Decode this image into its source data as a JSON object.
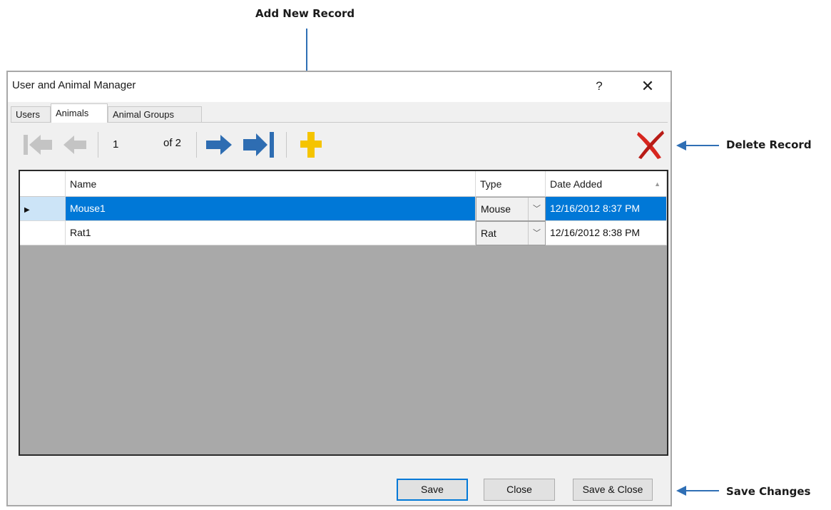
{
  "callouts": {
    "add_new_record": "Add New Record",
    "delete_record": "Delete Record",
    "save_changes": "Save Changes"
  },
  "dialog": {
    "title": "User and Animal Manager",
    "help_label": "?",
    "close_label": "✕"
  },
  "tabs": [
    {
      "label": "Users",
      "active": false
    },
    {
      "label": "Animals",
      "active": true
    },
    {
      "label": "Animal Groups",
      "active": false
    }
  ],
  "navigator": {
    "position": "1",
    "of_label": "of 2",
    "icons": [
      "move-first-icon",
      "move-previous-icon",
      "move-next-icon",
      "move-last-icon",
      "add-new-icon",
      "delete-icon"
    ]
  },
  "grid": {
    "columns": [
      "Name",
      "Type",
      "Date Added"
    ],
    "sort_indicator": "▲",
    "rows": [
      {
        "name": "Mouse1",
        "type": "Mouse",
        "date_added": "12/16/2012 8:37 PM",
        "selected": true,
        "row_marker": "▶"
      },
      {
        "name": "Rat1",
        "type": "Rat",
        "date_added": "12/16/2012 8:38 PM",
        "selected": false,
        "row_marker": ""
      }
    ],
    "combo_arrow": "﹀"
  },
  "buttons": {
    "save": "Save",
    "close": "Close",
    "save_close": "Save & Close"
  },
  "colors": {
    "selection": "#0078d7",
    "arrow_blue": "#2e6db2",
    "add_yellow": "#f5c400",
    "delete_red": "#d7261f",
    "grid_background": "#a9a9a9"
  }
}
